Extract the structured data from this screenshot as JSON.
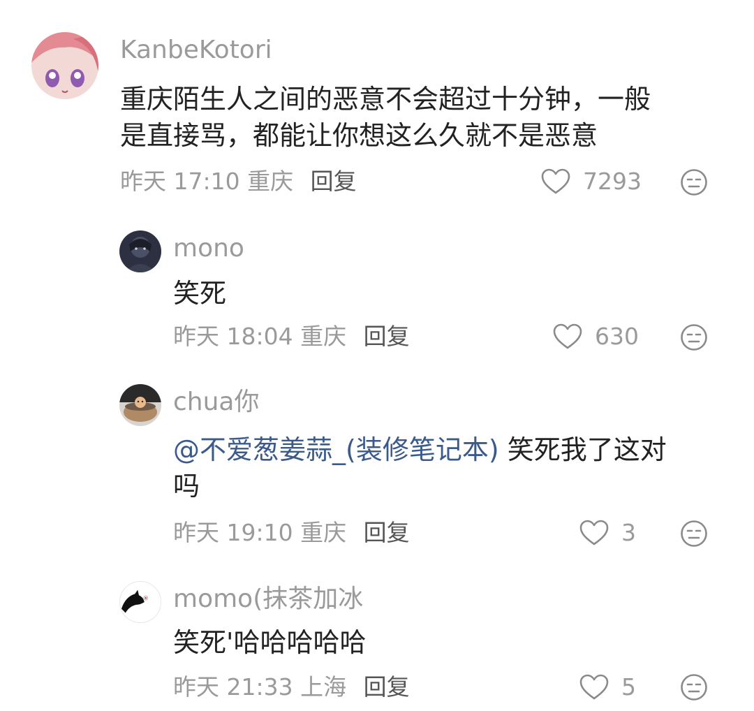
{
  "comments": [
    {
      "username": "KanbeKotori",
      "content_lines": [
        "重庆陌生人之间的恶意不会超过十分钟，一般",
        "是直接骂，都能让你想这么久就不是恶意"
      ],
      "time": "昨天 17:10",
      "location": "重庆",
      "reply_label": "回复",
      "likes": "7293"
    },
    {
      "username": "mono",
      "content_lines": [
        "笑死"
      ],
      "time": "昨天 18:04",
      "location": "重庆",
      "reply_label": "回复",
      "likes": "630"
    },
    {
      "username": "chua你",
      "mention": "@不爱葱姜蒜_(装修笔记本)",
      "content_after_mention": " 笑死我了这对",
      "content_line2": "吗",
      "time": "昨天 19:10",
      "location": "重庆",
      "reply_label": "回复",
      "likes": "3"
    },
    {
      "username": "momo(抹茶加冰",
      "content_lines": [
        "笑死'哈哈哈哈哈"
      ],
      "time": "昨天 21:33",
      "location": "上海",
      "reply_label": "回复",
      "likes": "5"
    }
  ],
  "icons": {
    "like": "heart-outline-icon",
    "dislike": "meh-face-icon"
  },
  "colors": {
    "mention": "#3b5a8c",
    "meta": "#9a9a9a",
    "text": "#222222"
  }
}
